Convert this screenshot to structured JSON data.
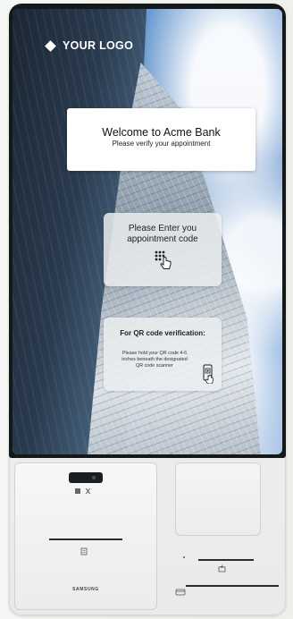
{
  "header": {
    "logo_text": "YOUR LOGO",
    "logo_icon": "diamond-icon"
  },
  "welcome": {
    "title": "Welcome to Acme Bank",
    "subtitle": "Please verify your appointment"
  },
  "appointment_code": {
    "line1": "Please Enter you",
    "line2": "appointment code",
    "icon": "keypad-touch-icon"
  },
  "qr_verification": {
    "title": "For QR code verification:",
    "instructions": "Please hold your QR code 4-6 inches beneath the designated QR code scanner",
    "icon": "phone-qr-icon"
  },
  "hardware": {
    "brand": "SAMSUNG"
  },
  "colors": {
    "bezel": "#151819",
    "kiosk_body": "#eeefee",
    "card_white": "#ffffff",
    "glass_card": "#eceef0"
  }
}
